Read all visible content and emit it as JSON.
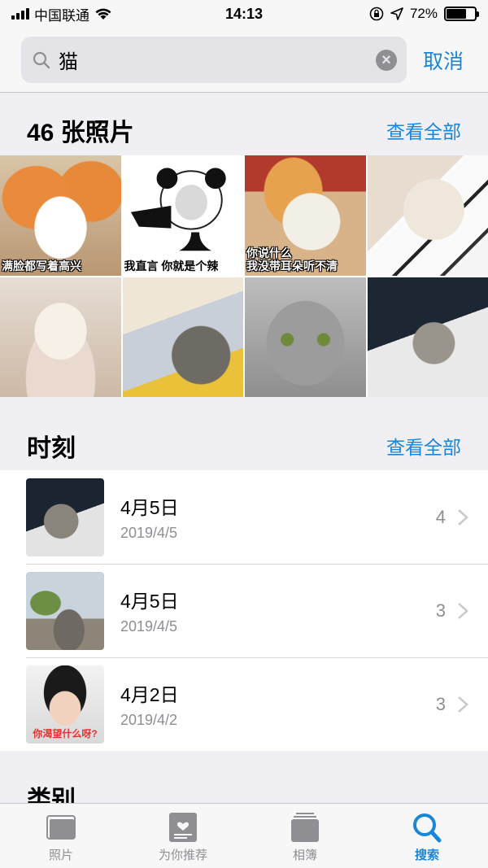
{
  "status_bar": {
    "carrier": "中国联通",
    "time": "14:13",
    "battery": "72%",
    "battery_level": 0.72
  },
  "search": {
    "value": "猫",
    "cancel_label": "取消"
  },
  "photos_section": {
    "title": "46 张照片",
    "see_all": "查看全部",
    "photos": [
      {
        "caption": "满脸都写着高兴"
      },
      {
        "caption": "我直言 你就是个辣"
      },
      {
        "caption_line1": "你说什么",
        "caption_line2": "我没带耳朵听不清"
      },
      {
        "caption": ""
      },
      {
        "caption": ""
      },
      {
        "caption": ""
      },
      {
        "caption": ""
      },
      {
        "caption": ""
      }
    ]
  },
  "moments_section": {
    "title": "时刻",
    "see_all": "查看全部",
    "items": [
      {
        "title": "4月5日",
        "date": "2019/4/5",
        "count": "4"
      },
      {
        "title": "4月5日",
        "date": "2019/4/5",
        "count": "3"
      },
      {
        "title": "4月2日",
        "date": "2019/4/2",
        "count": "3",
        "thumb_caption": "你渴望什么呀?"
      }
    ]
  },
  "categories_section": {
    "title": "类别"
  },
  "tab_bar": {
    "tabs": [
      {
        "label": "照片",
        "icon": "photos-icon",
        "active": false
      },
      {
        "label": "为你推荐",
        "icon": "for-you-icon",
        "active": false
      },
      {
        "label": "相簿",
        "icon": "albums-icon",
        "active": false
      },
      {
        "label": "搜索",
        "icon": "search-icon",
        "active": true
      }
    ]
  },
  "colors": {
    "accent": "#1a86d8",
    "background": "#efeff4"
  }
}
